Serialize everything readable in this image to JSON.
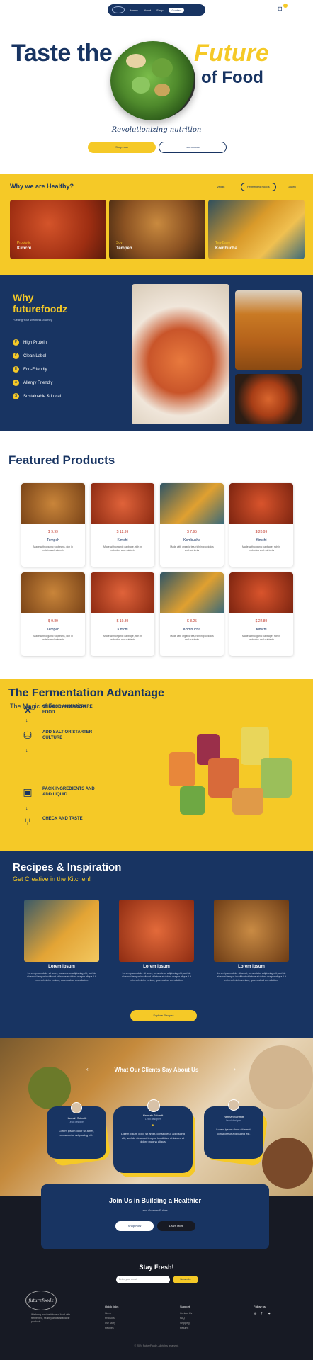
{
  "nav": {
    "items": [
      "Home",
      "About",
      "Shop",
      "Contact"
    ]
  },
  "hero": {
    "title": "Taste the",
    "title_accent": "Future",
    "title_end": "of Food",
    "tagline": "Revolutionizing nutrition",
    "shop_button": "Shop now",
    "learn_button": "Learn more"
  },
  "healthy": {
    "title": "Why we are Healthy?",
    "filters": [
      "Vegan",
      "Fermented Foods",
      "Gluten"
    ],
    "cards": [
      {
        "sub": "Probiotic",
        "name": "Kimchi"
      },
      {
        "sub": "Soy",
        "name": "Tempeh"
      },
      {
        "sub": "Tea-Base",
        "name": "Kombucha"
      }
    ]
  },
  "why": {
    "title": "Why futurefoodz",
    "subtitle": "Fuelling Your Wellness Journey",
    "items": [
      "High Protein",
      "Clean Label",
      "Eco-Friendly",
      "Allergy Friendly",
      "Sustainable & Local"
    ],
    "icons": [
      "P",
      "C",
      "E",
      "A",
      "S"
    ]
  },
  "featured": {
    "title": "Featured Products",
    "products": [
      {
        "price": "$ 9.99",
        "old": "",
        "name": "Tempeh",
        "desc": "Made with organic soybeans, rich in protein and nutrients"
      },
      {
        "price": "$ 12.99",
        "old": "",
        "name": "Kimchi",
        "desc": "Made with organic cabbage, rich in probiotics and nutrients"
      },
      {
        "price": "$ 7.95",
        "old": "",
        "name": "Kombucha",
        "desc": "Made with organic tea, rich in probiotics and nutrients"
      },
      {
        "price": "$ 20.99",
        "old": "",
        "name": "Kimchi",
        "desc": "Made with organic cabbage, rich in probiotics and nutrients"
      },
      {
        "price": "$ 9.89",
        "old": "",
        "name": "Tempeh",
        "desc": "Made with organic soybeans, rich in protein and nutrients"
      },
      {
        "price": "$ 19.89",
        "old": "",
        "name": "Kimchi",
        "desc": "Made with organic cabbage, rich in probiotics and nutrients"
      },
      {
        "price": "$ 8.25",
        "old": "",
        "name": "Kombucha",
        "desc": "Made with organic tea, rich in probiotics and nutrients"
      },
      {
        "price": "$ 22.89",
        "old": "",
        "name": "Kimchi",
        "desc": "Made with organic cabbage, rich in probiotics and nutrients"
      }
    ]
  },
  "fermentation": {
    "title": "The Fermentation Advantage",
    "subtitle": "The Magic of Fermentation...",
    "steps": [
      "CHOOSE AND PREPARE FOOD",
      "ADD SALT OR STARTER CULTURE",
      "PACK INGREDIENTS AND ADD LIQUID",
      "CHECK AND TASTE"
    ]
  },
  "recipes": {
    "title": "Recipes & Inspiration",
    "subtitle": "Get Creative in the Kitchen!",
    "cards": [
      {
        "name": "Lorem Ipsum",
        "desc": "Lorem ipsum dolor sit amet, consectetur adipiscing elit, sed do eiusmod tempor incididunt ut labore et dolore magna aliqua. Ut enim ad minim veniam, quis nostrud exercitation."
      },
      {
        "name": "Lorem Ipsum",
        "desc": "Lorem ipsum dolor sit amet, consectetur adipiscing elit, sed do eiusmod tempor incididunt ut labore et dolore magna aliqua. Ut enim ad minim veniam, quis nostrud exercitation."
      },
      {
        "name": "Lorem Ipsum",
        "desc": "Lorem ipsum dolor sit amet, consectetur adipiscing elit, sed do eiusmod tempor incididunt ut labore et dolore magna aliqua. Ut enim ad minim veniam, quis nostrud exercitation."
      }
    ],
    "button": "Explore Recipes"
  },
  "testimonials": {
    "title": "What Our Clients Say About Us",
    "clients": [
      {
        "name": "Hannah Schmitt",
        "role": "Lead designer",
        "quote": "Lorem ipsum dolor sit amet, consectetur adipiscing elit."
      },
      {
        "name": "Hannah Schmitt",
        "role": "Lead designer",
        "quote": "Lorem ipsum dolor sit amet, consectetur adipiscing elit, sed do eiusmod tempor incididunt ut labore et dolore magna aliqua."
      },
      {
        "name": "Hannah Schmitt",
        "role": "Lead designer",
        "quote": "Lorem ipsum dolor sit amet, consectetur adipiscing elit."
      }
    ]
  },
  "join": {
    "title": "Join Us in Building a Healthier",
    "subtitle": "and Greener Future",
    "btn1": "Shop Now",
    "btn2": "Learn More"
  },
  "footer": {
    "stay_title": "Stay Fresh!",
    "email_placeholder": "Enter your email",
    "subscribe": "Subscribe",
    "logo_text": "futurefoodz",
    "desc": "We bring you the future of food with fermented, healthy and sustainable products.",
    "col1_title": "Quick links",
    "col1_links": [
      "Home",
      "Products",
      "Our Story",
      "Recipes"
    ],
    "col2_title": "Support",
    "col2_links": [
      "Contact Us",
      "FAQ",
      "Shipping",
      "Returns"
    ],
    "col3_title": "Follow us",
    "copyright": "© 2024 FutureFoodz. All rights reserved."
  }
}
